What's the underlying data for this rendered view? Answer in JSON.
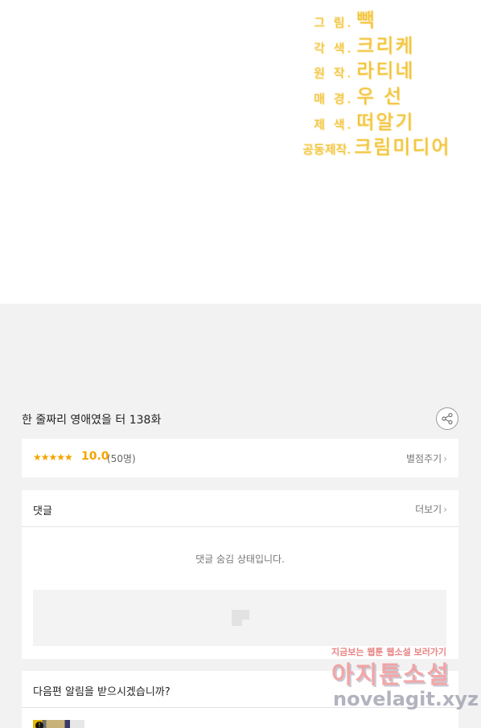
{
  "credits": [
    {
      "role": "그 림.",
      "name": "빽"
    },
    {
      "role": "각 색.",
      "name": "크리케"
    },
    {
      "role": "원 작.",
      "name": "라티네"
    },
    {
      "role": "매 경.",
      "name": "우 선"
    },
    {
      "role": "제 색.",
      "name": "떠알기"
    },
    {
      "role": "공동제작.",
      "name": "크림미디어"
    }
  ],
  "episode": {
    "title": "한 줄짜리 영애였을 터 138화"
  },
  "rating": {
    "stars": "★★★★★",
    "score": "10.0",
    "count": "(50명)",
    "action": "별점주기",
    "chevron": "›"
  },
  "comments": {
    "heading": "댓글",
    "more": "더보기",
    "chevron": "›",
    "hidden_message": "댓글 숨김 상태입니다."
  },
  "notify": {
    "question": "다음편 알림을 받으시겠습니까?"
  },
  "watermark": {
    "top": "지금보는 웹툰 웹소설 보러가기",
    "brand": "아지툰소설",
    "domain": "novelagit.xyz"
  },
  "colors": {
    "accent": "#f5a300",
    "credits": "#f0c43a"
  }
}
